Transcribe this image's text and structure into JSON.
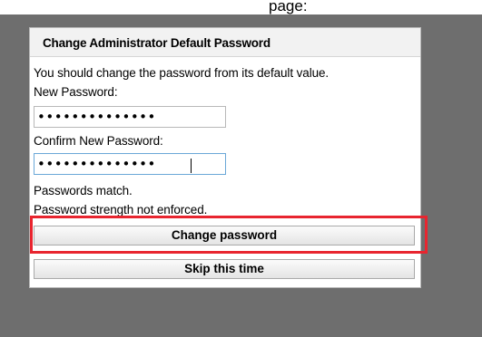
{
  "page_banner": {
    "partial_text": "page:"
  },
  "dialog": {
    "title": "Change Administrator Default Password",
    "instruction": "You should change the password from its default value.",
    "new_password": {
      "label": "New Password:",
      "value": "••••••••••••••"
    },
    "confirm_password": {
      "label": "Confirm New Password:",
      "value": "••••••••••••••"
    },
    "status": {
      "match": "Passwords match.",
      "strength": "Password strength not enforced."
    },
    "buttons": {
      "change": "Change password",
      "skip": "Skip this time"
    }
  },
  "colors": {
    "backdrop": "#6e6e6e",
    "highlight": "#e8252f",
    "header_bg": "#f2f2f2"
  }
}
